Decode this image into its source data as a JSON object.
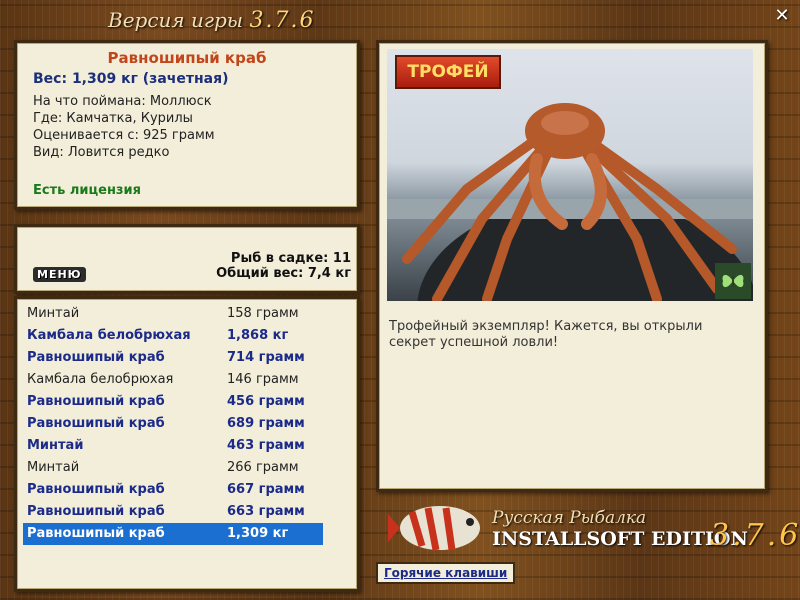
{
  "window": {
    "title_prefix": "Версия игры",
    "title_version": "3.7.6"
  },
  "fish_info": {
    "name": "Равношипый краб",
    "weight": "Вес: 1,309 кг (зачетная)",
    "lines": [
      "На что поймана: Моллюск",
      "Где: Камчатка, Курилы",
      "Оценивается с: 925 грамм",
      "Вид: Ловится редко"
    ],
    "license": "Есть лицензия"
  },
  "menu": {
    "label": "МЕНЮ",
    "fish_count": "Рыб в садке: 11",
    "total_weight": "Общий вес: 7,4 кг"
  },
  "catch_list": [
    {
      "name": "Минтай",
      "weight": "158 грамм",
      "style": "normal"
    },
    {
      "name": "Камбала белобрюхая",
      "weight": "1,868 кг",
      "style": "bold"
    },
    {
      "name": "Равношипый краб",
      "weight": "714 грамм",
      "style": "bold"
    },
    {
      "name": "Камбала белобрюхая",
      "weight": "146 грамм",
      "style": "normal"
    },
    {
      "name": "Равношипый краб",
      "weight": "456 грамм",
      "style": "bold"
    },
    {
      "name": "Равношипый краб",
      "weight": "689 грамм",
      "style": "bold"
    },
    {
      "name": "Минтай",
      "weight": "463 грамм",
      "style": "bold"
    },
    {
      "name": "Минтай",
      "weight": "266 грамм",
      "style": "normal"
    },
    {
      "name": "Равношипый краб",
      "weight": "667 грамм",
      "style": "bold"
    },
    {
      "name": "Равношипый краб",
      "weight": "663 грамм",
      "style": "bold"
    },
    {
      "name": "Равношипый краб",
      "weight": "1,309 кг",
      "style": "sel"
    }
  ],
  "photo": {
    "badge": "ТРОФЕЙ",
    "description": "Трофейный экземпляр! Кажется, вы открыли секрет успешной ловли!"
  },
  "brand": {
    "line1": "Русская Рыбалка",
    "line2": "INSTALLSOFT EDITION",
    "version": "3.7.6"
  },
  "hotkeys_label": "Горячие клавиши"
}
